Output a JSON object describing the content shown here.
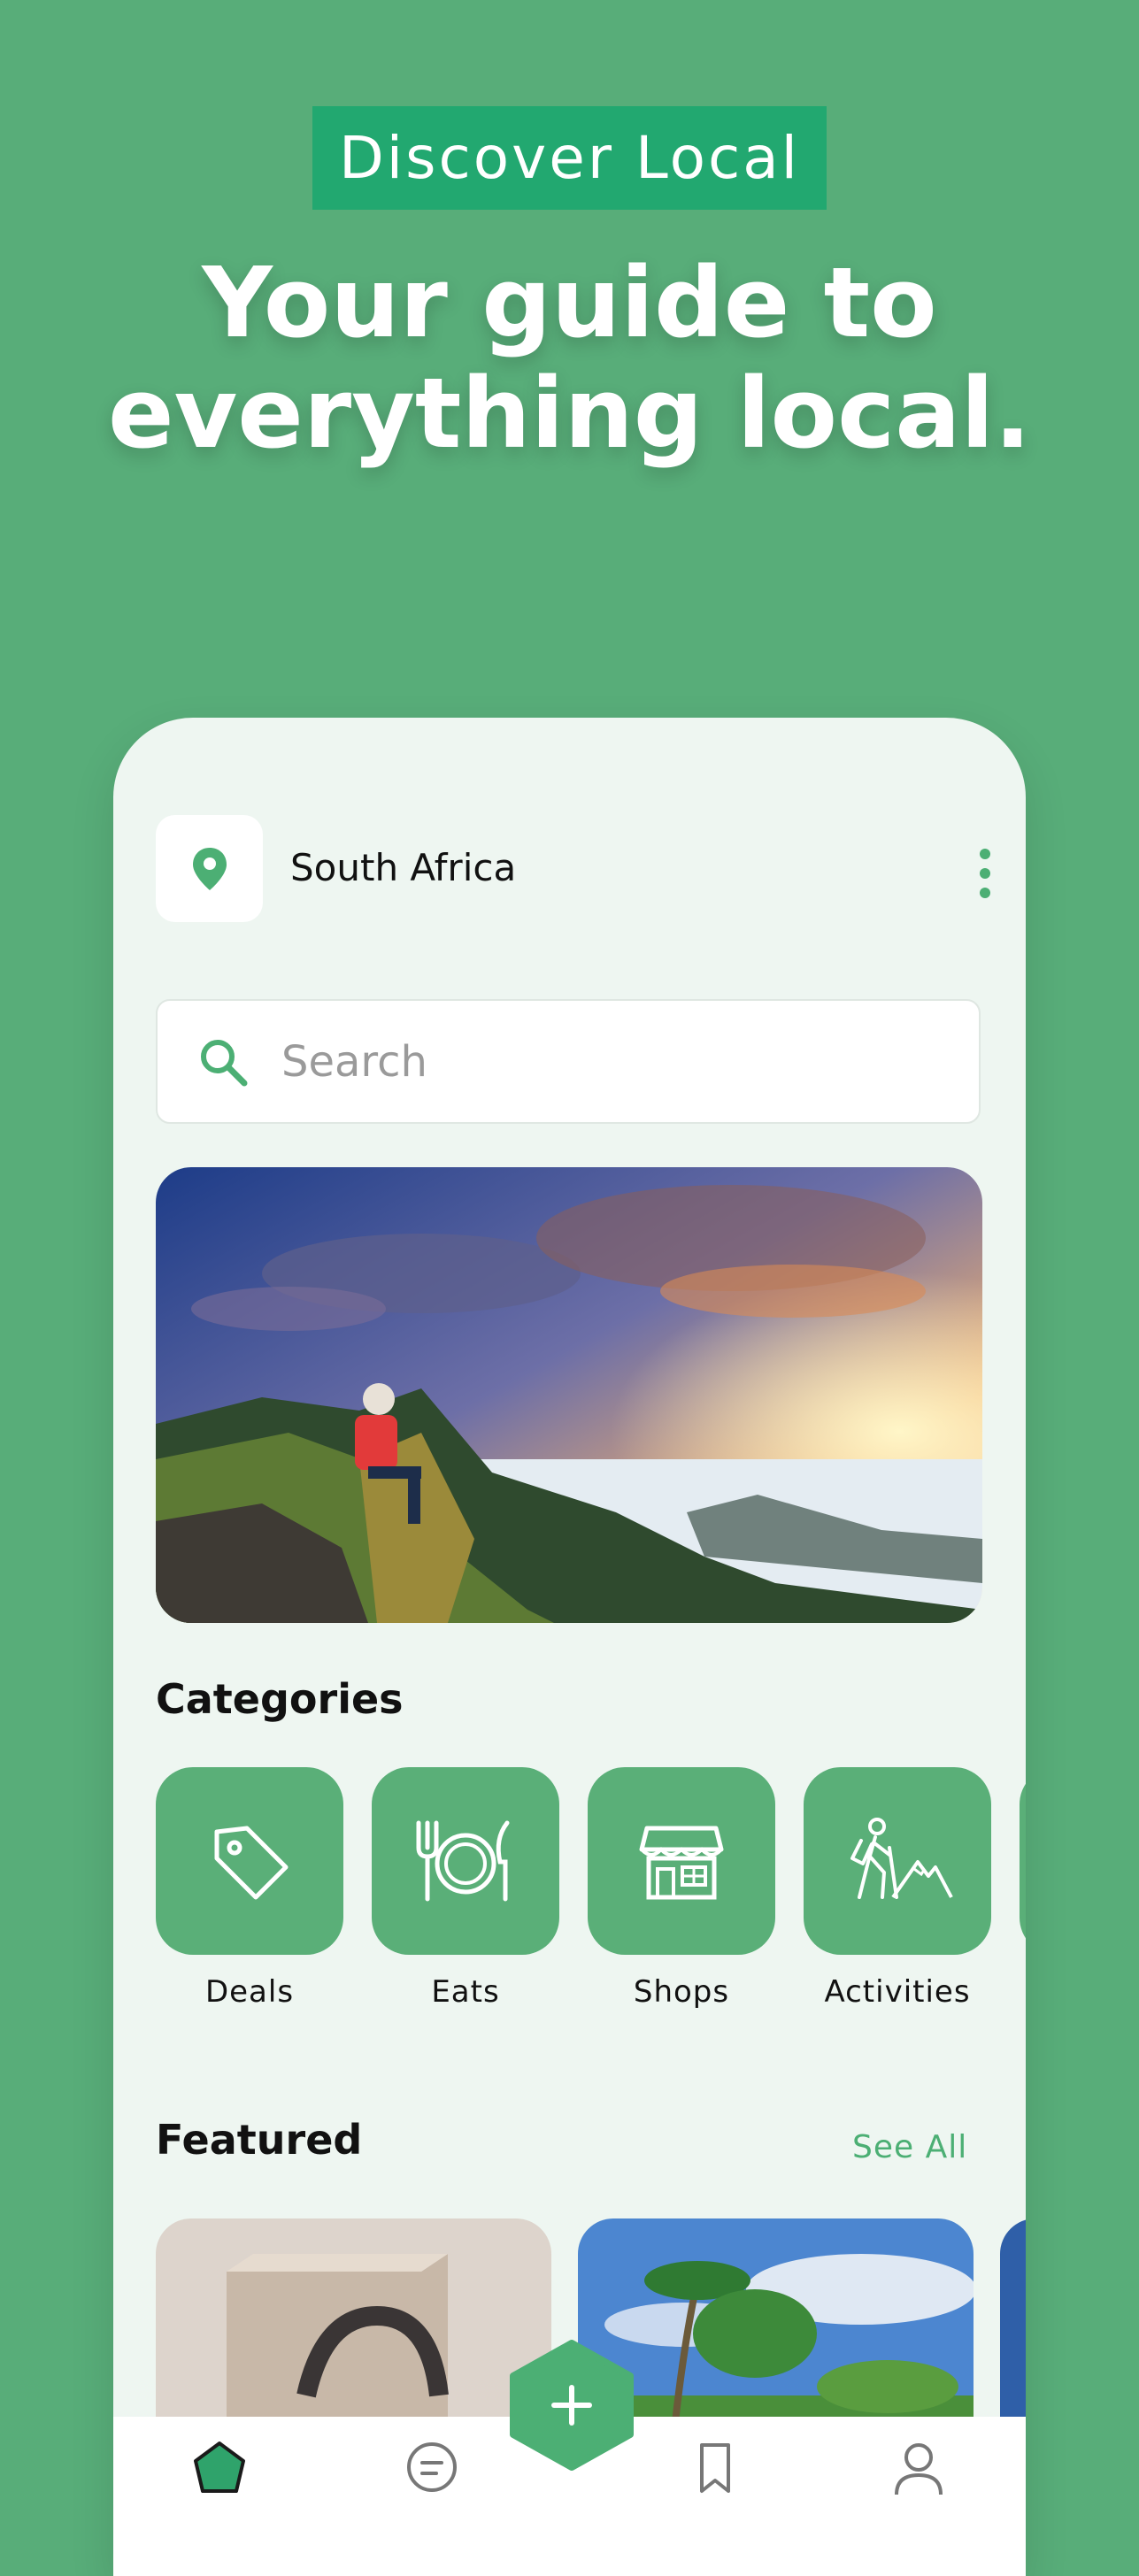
{
  "promo": {
    "badge": "Discover Local",
    "headline_line1": "Your guide to",
    "headline_line2": "everything local."
  },
  "app": {
    "location": {
      "label": "South Africa",
      "icon": "location-pin-icon"
    },
    "menu_icon": "more-vertical-icon",
    "search": {
      "placeholder": "Search",
      "value": "",
      "icon": "search-icon"
    },
    "categories": {
      "title": "Categories",
      "items": [
        {
          "label": "Deals",
          "icon": "tag-icon"
        },
        {
          "label": "Eats",
          "icon": "cutlery-icon"
        },
        {
          "label": "Shops",
          "icon": "storefront-icon"
        },
        {
          "label": "Activities",
          "icon": "hiker-icon"
        }
      ]
    },
    "featured": {
      "title": "Featured",
      "see_all": "See All"
    },
    "nav": [
      "home-icon",
      "messages-icon",
      "add-icon",
      "bookmark-icon",
      "profile-icon"
    ]
  },
  "colors": {
    "background": "#58ad79",
    "badge": "#22a870",
    "accent": "#4caf74",
    "tile": "#5aaf78",
    "panel": "#eef6f1"
  }
}
